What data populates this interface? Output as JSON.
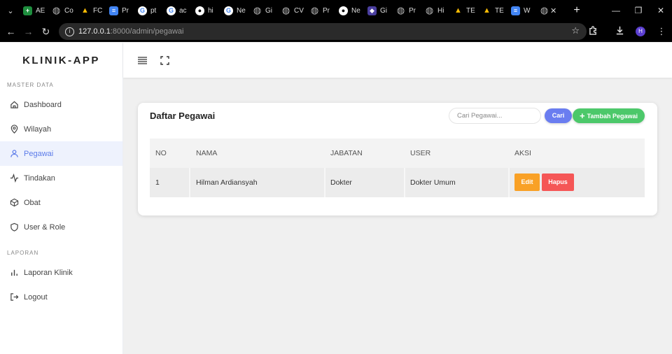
{
  "browser": {
    "tabs": [
      {
        "label": "AE",
        "icon": "sheets-icon",
        "color": "#1e8e3e"
      },
      {
        "label": "Co",
        "icon": "globe-icon",
        "color": "#5f6368"
      },
      {
        "label": "FC",
        "icon": "drive-icon",
        "color": "#1a73e8"
      },
      {
        "label": "Pr",
        "icon": "docs-icon",
        "color": "#4285f4"
      },
      {
        "label": "pt",
        "icon": "google-icon",
        "color": "#ffffff"
      },
      {
        "label": "ac",
        "icon": "google-icon",
        "color": "#ffffff"
      },
      {
        "label": "hi",
        "icon": "github-icon",
        "color": "#ffffff"
      },
      {
        "label": "Ne",
        "icon": "google-icon",
        "color": "#ffffff"
      },
      {
        "label": "Gi",
        "icon": "globe-icon",
        "color": "#5f6368"
      },
      {
        "label": "CV",
        "icon": "globe-icon",
        "color": "#5f6368"
      },
      {
        "label": "Pr",
        "icon": "globe-icon",
        "color": "#5f6368"
      },
      {
        "label": "Ne",
        "icon": "github-icon",
        "color": "#ffffff"
      },
      {
        "label": "Gi",
        "icon": "gitlab-icon",
        "color": "#4b3fa0"
      },
      {
        "label": "Pr",
        "icon": "globe-icon",
        "color": "#5f6368"
      },
      {
        "label": "Hi",
        "icon": "globe-icon",
        "color": "#5f6368"
      },
      {
        "label": "TE",
        "icon": "drive-icon",
        "color": "#1a73e8"
      },
      {
        "label": "TE",
        "icon": "drive-icon",
        "color": "#1a73e8"
      },
      {
        "label": "W",
        "icon": "docs-icon",
        "color": "#4285f4"
      },
      {
        "label": "",
        "icon": "globe-icon",
        "color": "#5f6368",
        "active": true
      }
    ],
    "url_host": "127.0.0.1",
    "url_rest": ":8000/admin/pegawai",
    "profile_initial": "H"
  },
  "sidebar": {
    "brand": "KLINIK-APP",
    "master_label": "MASTER DATA",
    "master_items": [
      {
        "label": "Dashboard",
        "icon": "home-icon"
      },
      {
        "label": "Wilayah",
        "icon": "map-pin-icon"
      },
      {
        "label": "Pegawai",
        "icon": "user-icon",
        "active": true
      },
      {
        "label": "Tindakan",
        "icon": "activity-icon"
      },
      {
        "label": "Obat",
        "icon": "box-icon"
      },
      {
        "label": "User & Role",
        "icon": "shield-icon"
      }
    ],
    "report_label": "LAPORAN",
    "report_items": [
      {
        "label": "Laporan Klinik",
        "icon": "bar-chart-icon"
      },
      {
        "label": "Logout",
        "icon": "logout-icon"
      }
    ]
  },
  "card": {
    "title": "Daftar Pegawai",
    "search_placeholder": "Cari Pegawai...",
    "search_button": "Cari",
    "add_button": "Tambah Pegawai"
  },
  "table": {
    "headers": [
      "NO",
      "NAMA",
      "JABATAN",
      "USER",
      "AKSI"
    ],
    "rows": [
      {
        "no": "1",
        "nama": "Hilman Ardiansyah",
        "jabatan": "Dokter",
        "user": "Dokter Umum",
        "edit": "Edit",
        "hapus": "Hapus"
      }
    ]
  },
  "colors": {
    "accent": "#5b7be9",
    "cari": "#6a7df0",
    "tambah": "#4cc86a",
    "edit": "#f9a126",
    "hapus": "#f55656"
  }
}
